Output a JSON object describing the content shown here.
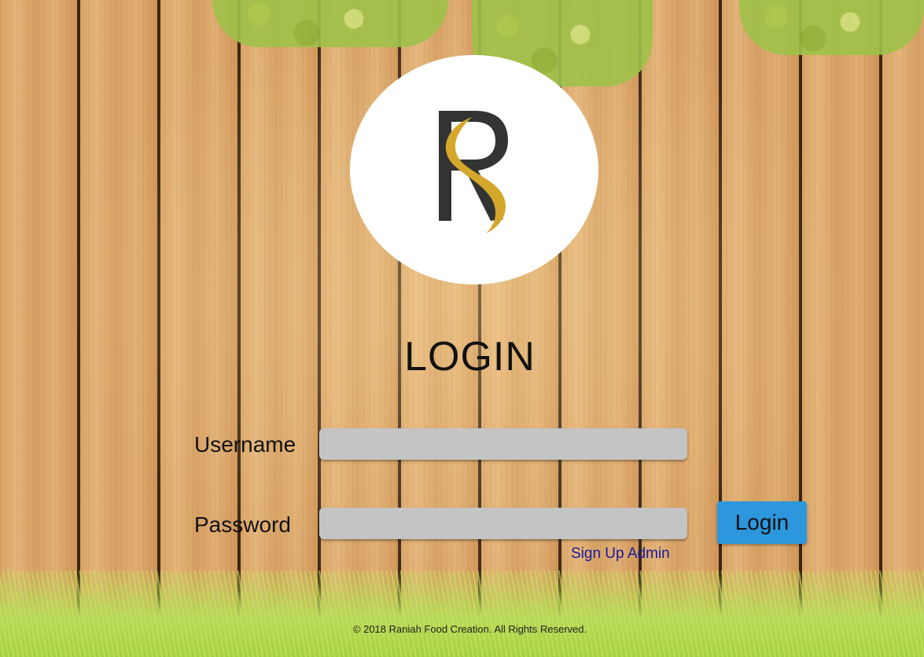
{
  "logo": {
    "icon": "raniah-r-logo-icon",
    "letter": "R",
    "colors": {
      "dark": "#333333",
      "gold": "#d4a72c"
    }
  },
  "title": "LOGIN",
  "form": {
    "username_label": "Username",
    "username_value": "",
    "password_label": "Password",
    "password_value": "",
    "login_label": "Login",
    "signup_label": "Sign Up Admin"
  },
  "footer": "© 2018 Raniah Food Creation. All Rights Reserved.",
  "colors": {
    "button": "#2d97de",
    "field": "#c4c4c4",
    "link": "#1a1a9e"
  }
}
